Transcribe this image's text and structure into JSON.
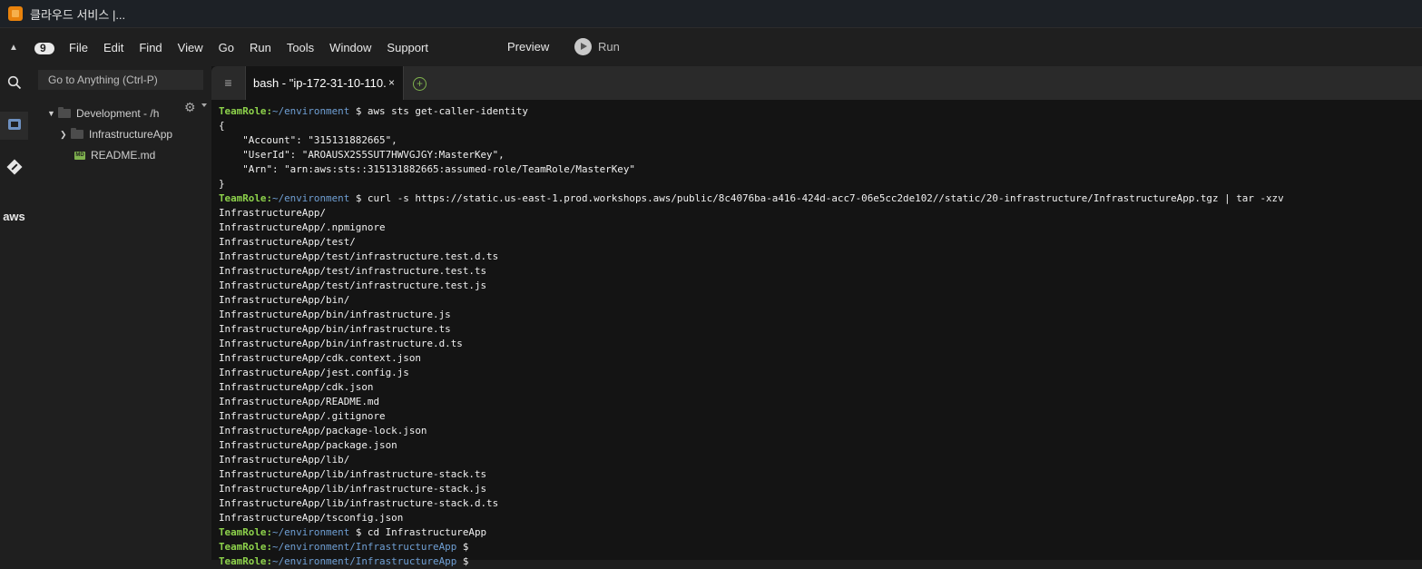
{
  "window": {
    "title": "클라우드 서비스 |..."
  },
  "menubar": {
    "items": [
      "File",
      "Edit",
      "Find",
      "View",
      "Go",
      "Run",
      "Tools",
      "Window",
      "Support"
    ],
    "preview_label": "Preview",
    "run_label": "Run"
  },
  "rail": {
    "aws_label": "aws"
  },
  "explorer": {
    "goto_placeholder": "Go to Anything (Ctrl-P)",
    "root_label": "Development - /h",
    "items": [
      {
        "label": "InfrastructureApp",
        "type": "folder"
      },
      {
        "label": "README.md",
        "type": "file",
        "badge": "MD"
      }
    ]
  },
  "tabs": {
    "active_label": "bash - \"ip-172-31-10-110.",
    "close_glyph": "×",
    "add_glyph": "+"
  },
  "terminal": {
    "prompt_role": "TeamRole:",
    "lines": [
      {
        "kind": "prompt",
        "path": "~/environment",
        "cmd": " $ aws sts get-caller-identity"
      },
      {
        "kind": "out",
        "text": "{"
      },
      {
        "kind": "out",
        "text": "    \"Account\": \"315131882665\","
      },
      {
        "kind": "out",
        "text": "    \"UserId\": \"AROAUSX2S5SUT7HWVGJGY:MasterKey\","
      },
      {
        "kind": "out",
        "text": "    \"Arn\": \"arn:aws:sts::315131882665:assumed-role/TeamRole/MasterKey\""
      },
      {
        "kind": "out",
        "text": "}"
      },
      {
        "kind": "prompt",
        "path": "~/environment",
        "cmd": " $ curl -s https://static.us-east-1.prod.workshops.aws/public/8c4076ba-a416-424d-acc7-06e5cc2de102//static/20-infrastructure/InfrastructureApp.tgz | tar -xzv"
      },
      {
        "kind": "out",
        "text": "InfrastructureApp/"
      },
      {
        "kind": "out",
        "text": "InfrastructureApp/.npmignore"
      },
      {
        "kind": "out",
        "text": "InfrastructureApp/test/"
      },
      {
        "kind": "out",
        "text": "InfrastructureApp/test/infrastructure.test.d.ts"
      },
      {
        "kind": "out",
        "text": "InfrastructureApp/test/infrastructure.test.ts"
      },
      {
        "kind": "out",
        "text": "InfrastructureApp/test/infrastructure.test.js"
      },
      {
        "kind": "out",
        "text": "InfrastructureApp/bin/"
      },
      {
        "kind": "out",
        "text": "InfrastructureApp/bin/infrastructure.js"
      },
      {
        "kind": "out",
        "text": "InfrastructureApp/bin/infrastructure.ts"
      },
      {
        "kind": "out",
        "text": "InfrastructureApp/bin/infrastructure.d.ts"
      },
      {
        "kind": "out",
        "text": "InfrastructureApp/cdk.context.json"
      },
      {
        "kind": "out",
        "text": "InfrastructureApp/jest.config.js"
      },
      {
        "kind": "out",
        "text": "InfrastructureApp/cdk.json"
      },
      {
        "kind": "out",
        "text": "InfrastructureApp/README.md"
      },
      {
        "kind": "out",
        "text": "InfrastructureApp/.gitignore"
      },
      {
        "kind": "out",
        "text": "InfrastructureApp/package-lock.json"
      },
      {
        "kind": "out",
        "text": "InfrastructureApp/package.json"
      },
      {
        "kind": "out",
        "text": "InfrastructureApp/lib/"
      },
      {
        "kind": "out",
        "text": "InfrastructureApp/lib/infrastructure-stack.ts"
      },
      {
        "kind": "out",
        "text": "InfrastructureApp/lib/infrastructure-stack.js"
      },
      {
        "kind": "out",
        "text": "InfrastructureApp/lib/infrastructure-stack.d.ts"
      },
      {
        "kind": "out",
        "text": "InfrastructureApp/tsconfig.json"
      },
      {
        "kind": "prompt",
        "path": "~/environment",
        "cmd": " $ cd InfrastructureApp"
      },
      {
        "kind": "prompt",
        "path": "~/environment/InfrastructureApp",
        "cmd": " $"
      },
      {
        "kind": "prompt",
        "path": "~/environment/InfrastructureApp",
        "cmd": " $"
      }
    ]
  },
  "colors": {
    "prompt_role": "#8dd24b",
    "prompt_path": "#6f9fd4",
    "terminal_bg": "#141414",
    "accent_add": "#7fb24e"
  }
}
